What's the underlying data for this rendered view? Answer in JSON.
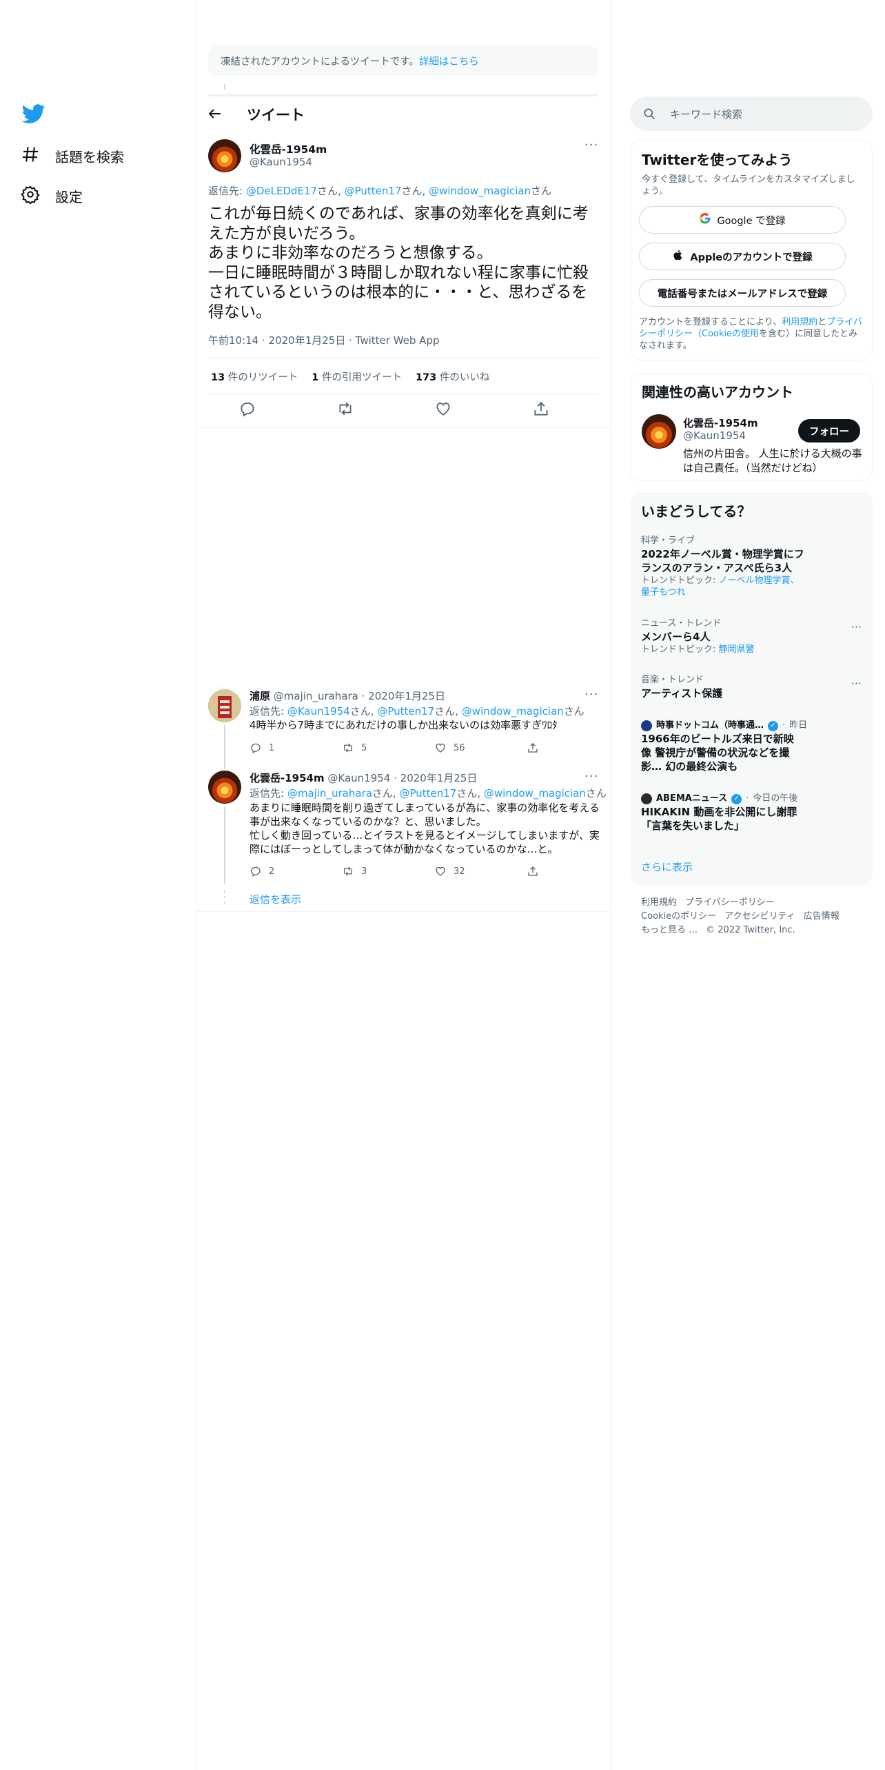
{
  "nav": {
    "explore_label": "話題を検索",
    "settings_label": "設定"
  },
  "notice": {
    "text": "凍結されたアカウントによるツイートです。",
    "link": "詳細はこちら"
  },
  "header": {
    "title": "ツイート"
  },
  "main_tweet": {
    "name": "化雲岳-1954m",
    "handle": "@Kaun1954",
    "reply_prefix": "返信先: ",
    "reply_users": [
      "@DeLEDdE17",
      "@Putten17",
      "@window_magician"
    ],
    "reply_suffix": "さん",
    "text": "これが毎日続くのであれば、家事の効率化を真剣に考えた方が良いだろう。\nあまりに非効率なのだろうと想像する。\n一日に睡眠時間が３時間しか取れない程に家事に忙殺されているというのは根本的に・・・と、思わざるを得ない。",
    "time": "午前10:14",
    "date": "2020年1月25日",
    "source": "Twitter Web App",
    "retweets": "13",
    "retweets_label": "件のリツイート",
    "quotes": "1",
    "quotes_label": "件の引用ツイート",
    "likes": "173",
    "likes_label": "件のいいね"
  },
  "replies": [
    {
      "name": "浦原",
      "handle": "@majin_urahara",
      "date": "2020年1月25日",
      "reply_prefix": "返信先: ",
      "reply_users": [
        "@Kaun1954",
        "@Putten17",
        "@window_magician"
      ],
      "reply_suffix": "さん",
      "text": "4時半から7時までにあれだけの事しか出来ないのは効率悪すぎﾜﾛﾀ",
      "reply_count": "1",
      "retweet_count": "5",
      "like_count": "56"
    },
    {
      "name": "化雲岳-1954m",
      "handle": "@Kaun1954",
      "date": "2020年1月25日",
      "reply_prefix": "返信先: ",
      "reply_users": [
        "@majin_urahara",
        "@Putten17",
        "@window_magician"
      ],
      "reply_suffix": "さん",
      "text": "あまりに睡眠時間を削り過ぎてしまっているが為に、家事の効率化を考える事が出来なくなっているのかな？と、思いました。\n忙しく動き回っている…とイラストを見るとイメージしてしまいますが、実際にはぼーっとしてしまって体が動かなくなっているのかな…と。",
      "reply_count": "2",
      "retweet_count": "3",
      "like_count": "32"
    }
  ],
  "show_replies": "返信を表示",
  "search": {
    "placeholder": "キーワード検索"
  },
  "signup": {
    "title": "Twitterを使ってみよう",
    "subtitle": "今すぐ登録して、タイムラインをカスタマイズしましょう。",
    "google": "Google で登録",
    "apple": "Appleのアカウントで登録",
    "phone": "電話番号またはメールアドレスで登録",
    "legal_1": "アカウントを登録することにより、",
    "legal_terms": "利用規約",
    "legal_2": "と",
    "legal_privacy": "プライバシーポリシー（Cookieの使用",
    "legal_3": "を含む）に同意したとみなされます。"
  },
  "related": {
    "title": "関連性の高いアカウント",
    "name": "化雲岳-1954m",
    "handle": "@Kaun1954",
    "follow": "フォロー",
    "bio": "信州の片田舎。 人生に於ける大概の事は自己責任。（当然だけどね）"
  },
  "trends": {
    "title": "いまどうしてる？",
    "items": [
      {
        "category": "科学・ライブ",
        "title": "2022年ノーベル賞・物理学賞にフランスのアラン・アスペ氏ら3人",
        "sub_prefix": "トレンドトピック: ",
        "sub_link": "ノーベル物理学賞、量子もつれ"
      },
      {
        "category": "ニュース・トレンド",
        "title": "メンバーら4人",
        "sub_prefix": "トレンドトピック: ",
        "sub_link": "静岡県警"
      },
      {
        "category": "音楽・トレンド",
        "title": "アーティスト保護"
      }
    ],
    "news": [
      {
        "source": "時事ドットコム（時事通…",
        "time": "昨日",
        "title": "1966年のビートルズ来日で新映像 警視庁が警備の状況などを撮影… 幻の最終公演も"
      },
      {
        "source": "ABEMAニュース",
        "time": "今日の午後",
        "title": "HIKAKIN 動画を非公開にし謝罪「言葉を失いました」"
      }
    ],
    "show_more": "さらに表示"
  },
  "footer": {
    "links": [
      "利用規約",
      "プライバシーポリシー",
      "Cookieのポリシー",
      "アクセシビリティ",
      "広告情報",
      "もっと見る …"
    ],
    "copyright": "© 2022 Twitter, Inc."
  },
  "colors": {
    "accent": "#1d9bf0",
    "text": "#0f1419",
    "muted": "#536471",
    "border": "#eff3f4"
  }
}
